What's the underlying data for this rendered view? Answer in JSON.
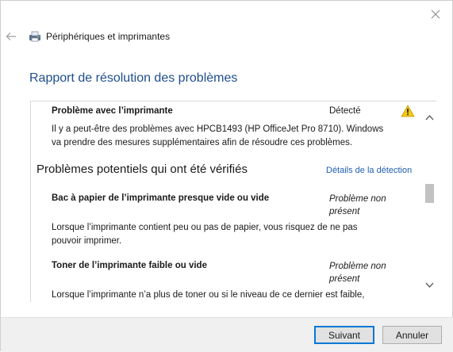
{
  "breadcrumb": {
    "label": "Périphériques et imprimantes"
  },
  "page_title": "Rapport de résolution des problèmes",
  "report": {
    "main_issue": {
      "title": "Problème avec l’imprimante",
      "status": "Détecté",
      "description_line1": "Il y a peut-être des problèmes avec HPCB1493 (HP OfficeJet Pro 8710). Windows",
      "description_line2": "va prendre des mesures supplémentaires afin de résoudre ces problèmes."
    },
    "section_heading": "Problèmes potentiels qui ont été vérifiés",
    "details_link": "Détails de la détection",
    "checks": [
      {
        "title": "Bac à papier de l’imprimante presque vide ou vide",
        "status_line1": "Problème non",
        "status_line2": "présent",
        "description_line1": "Lorsque l’imprimante contient peu ou pas de papier, vous risquez de ne pas",
        "description_line2": "pouvoir imprimer."
      },
      {
        "title": "Toner de l’imprimante faible ou vide",
        "status_line1": "Problème non",
        "status_line2": "présent",
        "description_line1": "Lorsque l’imprimante n’a plus de toner ou si le niveau de ce dernier est faible,"
      }
    ]
  },
  "buttons": {
    "next": "Suivant",
    "cancel": "Annuler"
  },
  "colors": {
    "title_blue": "#1f4e8c",
    "link_blue": "#1f5fb3",
    "warning_yellow": "#f2c811",
    "accent_border": "#0078d7"
  }
}
